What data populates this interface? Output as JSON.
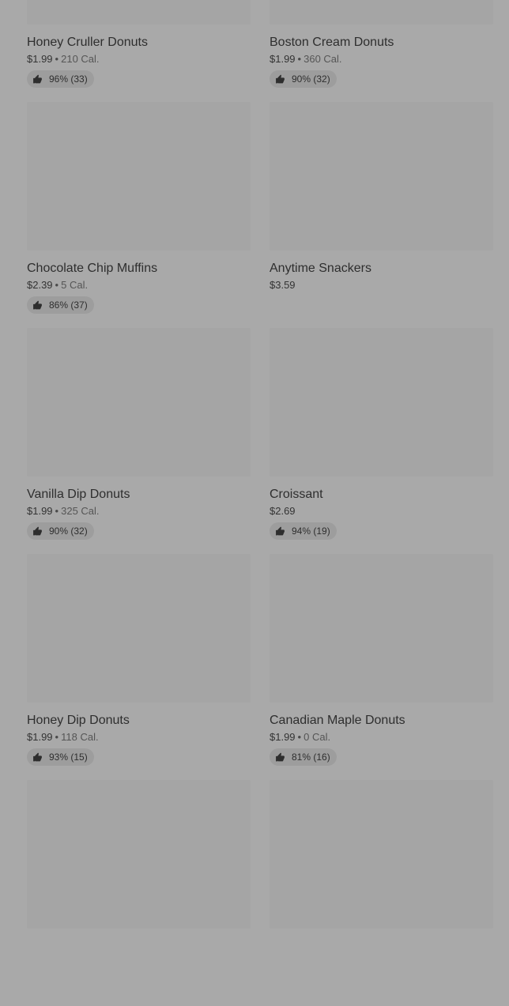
{
  "thumbs_icon": "thumbs-up-icon",
  "calorie_separator": "•",
  "items": [
    {
      "name": "Honey Cruller Donuts",
      "price": "$1.99",
      "calories": "210 Cal.",
      "rating": "96% (33)"
    },
    {
      "name": "Boston Cream Donuts",
      "price": "$1.99",
      "calories": "360 Cal.",
      "rating": "90% (32)"
    },
    {
      "name": "Chocolate Chip Muffins",
      "price": "$2.39",
      "calories": "5 Cal.",
      "rating": "86% (37)"
    },
    {
      "name": "Anytime Snackers",
      "price": "$3.59",
      "calories": null,
      "rating": null
    },
    {
      "name": "Vanilla Dip Donuts",
      "price": "$1.99",
      "calories": "325 Cal.",
      "rating": "90% (32)"
    },
    {
      "name": "Croissant",
      "price": "$2.69",
      "calories": null,
      "rating": "94% (19)"
    },
    {
      "name": "Honey Dip Donuts",
      "price": "$1.99",
      "calories": "118 Cal.",
      "rating": "93% (15)"
    },
    {
      "name": "Canadian Maple Donuts",
      "price": "$1.99",
      "calories": "0 Cal.",
      "rating": "81% (16)"
    },
    {
      "name": null,
      "price": null,
      "calories": null,
      "rating": null
    },
    {
      "name": null,
      "price": null,
      "calories": null,
      "rating": null
    }
  ]
}
